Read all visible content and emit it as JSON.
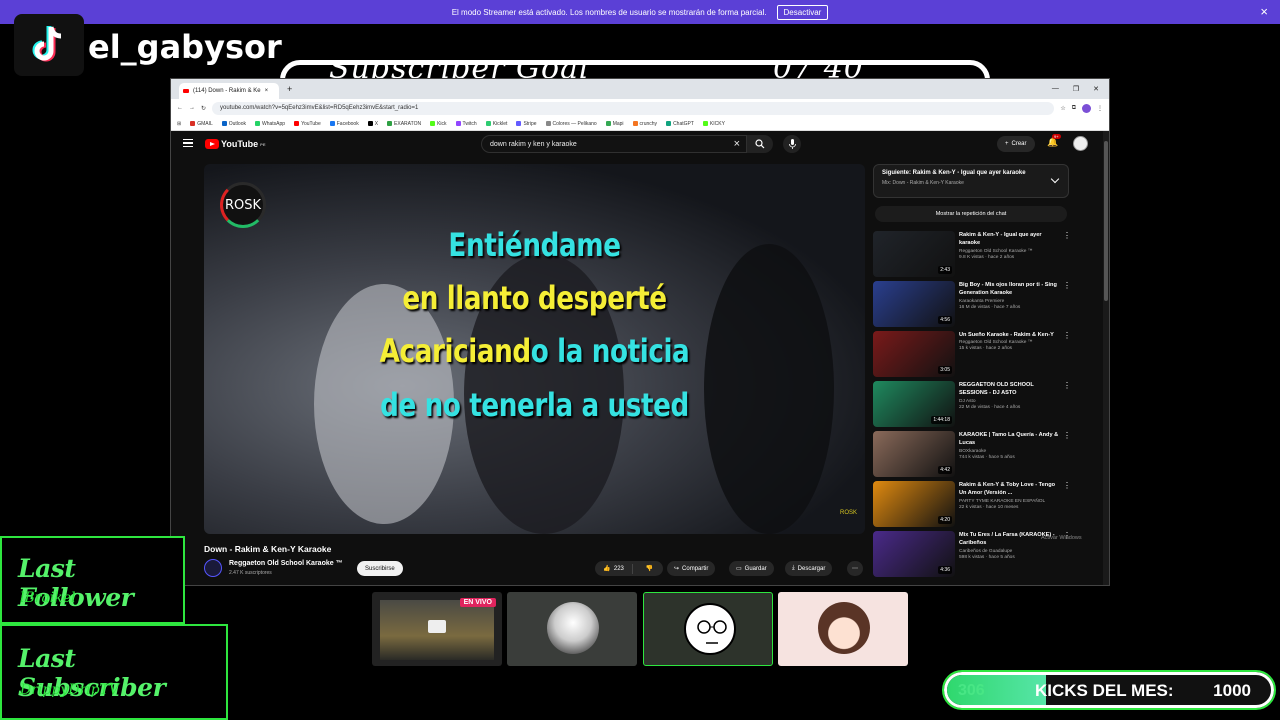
{
  "streamer_banner": {
    "message": "El modo Streamer está activado. Los nombres de usuario se mostrarán de forma parcial.",
    "button": "Desactivar",
    "close": "×"
  },
  "tiktok": {
    "username": "el_gabysor"
  },
  "goal_overlay": {
    "left_text": "Subscriber Goal",
    "right_text": "07 40"
  },
  "browser": {
    "tab_title": "(114) Down - Rakim & Ke",
    "url": "youtube.com/watch?v=5qEehz3imvE&list=RD5qEehz3imvE&start_radio=1",
    "bookmarks": [
      "GMAIL",
      "Outlook",
      "WhatsApp",
      "YouTube",
      "Facebook",
      "X",
      "EXARATON",
      "Kick",
      "Twitch",
      "Kicklet",
      "Stripe",
      "Colores — Pelikano",
      "Mapi",
      "crunchy",
      "ChatGPT",
      "KICKY"
    ],
    "bookmark_colors": [
      "#d93025",
      "#0a64c8",
      "#25d366",
      "#ff0000",
      "#1877f2",
      "#000000",
      "#2ea043",
      "#53fc18",
      "#9146ff",
      "#2ecc71",
      "#635bff",
      "#888888",
      "#34a853",
      "#f47521",
      "#10a37f",
      "#53fc18"
    ]
  },
  "youtube": {
    "logo": "YouTube",
    "region": "PE",
    "search_query": "down rakim y ken y karaoke",
    "create": "Crear",
    "notif_count": "9+",
    "video": {
      "brand": "ROSK",
      "lyrics": [
        "Entiéndame",
        "en llanto desperté",
        "Acariciando la noticia",
        "de no tenerla a usted"
      ],
      "watermark": "ROSK",
      "title": "Down - Rakim & Ken-Y Karaoke",
      "channel": "Reggaeton Old School Karaoke ™",
      "subs": "2.47 K suscriptores",
      "subscribe": "Suscribirse",
      "likes": "223",
      "share": "Compartir",
      "save": "Guardar",
      "download": "Descargar"
    },
    "next_up": {
      "title": "Siguiente: Rakim & Ken-Y - Igual que ayer karaoke",
      "subtitle": "Mix: Down - Rakim & Ken-Y Karaoke"
    },
    "chat_replay": "Mostrar la repetición del chat",
    "recommendations": [
      {
        "title": "Rakim & Ken-Y - Igual que ayer karaoke",
        "channel": "Reggaeton Old School Karaoke ™",
        "meta": "9.8 K vistas · hace 2 años",
        "duration": "2:43",
        "color": "#20242a"
      },
      {
        "title": "Big Boy - Mis ojos lloran por ti - Sing Generation Karaoke",
        "channel": "Karaokanta Premiere",
        "meta": "16 M de vistas · hace 7 años",
        "duration": "4:56",
        "color": "#2a3f8f"
      },
      {
        "title": "Un Sueño Karaoke - Rakim & Ken-Y",
        "channel": "Reggaeton Old School Karaoke ™",
        "meta": "15 k vistas · hace 2 años",
        "duration": "3:05",
        "color": "#7a1a1a"
      },
      {
        "title": "REGGAETON OLD SCHOOL SESSIONS - DJ ASTO",
        "channel": "DJ Asto",
        "meta": "22 M de vistas · hace 4 años",
        "duration": "1:44:18",
        "color": "#1f8a5f"
      },
      {
        "title": "KARAOKE | Tamo La Quería - Andy & Lucas",
        "channel": "BOXkaraoke",
        "meta": "744 k vistas · hace 5 años",
        "duration": "4:42",
        "color": "#8a6a5a"
      },
      {
        "title": "Rakim & Ken-Y & Toby Love - Tengo Un Amor (Versión ...",
        "channel": "PARTY TYME KARAOKE EN ESPAÑOL",
        "meta": "22 k vistas · hace 10 meses",
        "duration": "4:20",
        "color": "#e08a10"
      },
      {
        "title": "Mix Tu Eres / La Farsa (KARAOKE) - Caribeños",
        "channel": "Caribeños de Guadalupe",
        "meta": "598 k vistas · hace 5 años",
        "duration": "4:36",
        "color": "#4a2a8a"
      }
    ],
    "windows_activate": "Activar Windows"
  },
  "overlays": {
    "last_follower_label": "Last Follower",
    "last_follower_name": "lBraikel",
    "last_subscriber_label": "Last Subscriber",
    "last_subscriber_name": "DrippyDripTV",
    "live_badge": "EN VIVO"
  },
  "kicks": {
    "count": "306",
    "label": "KICKS DEL MES:",
    "goal": "1000",
    "progress": 0.306
  }
}
